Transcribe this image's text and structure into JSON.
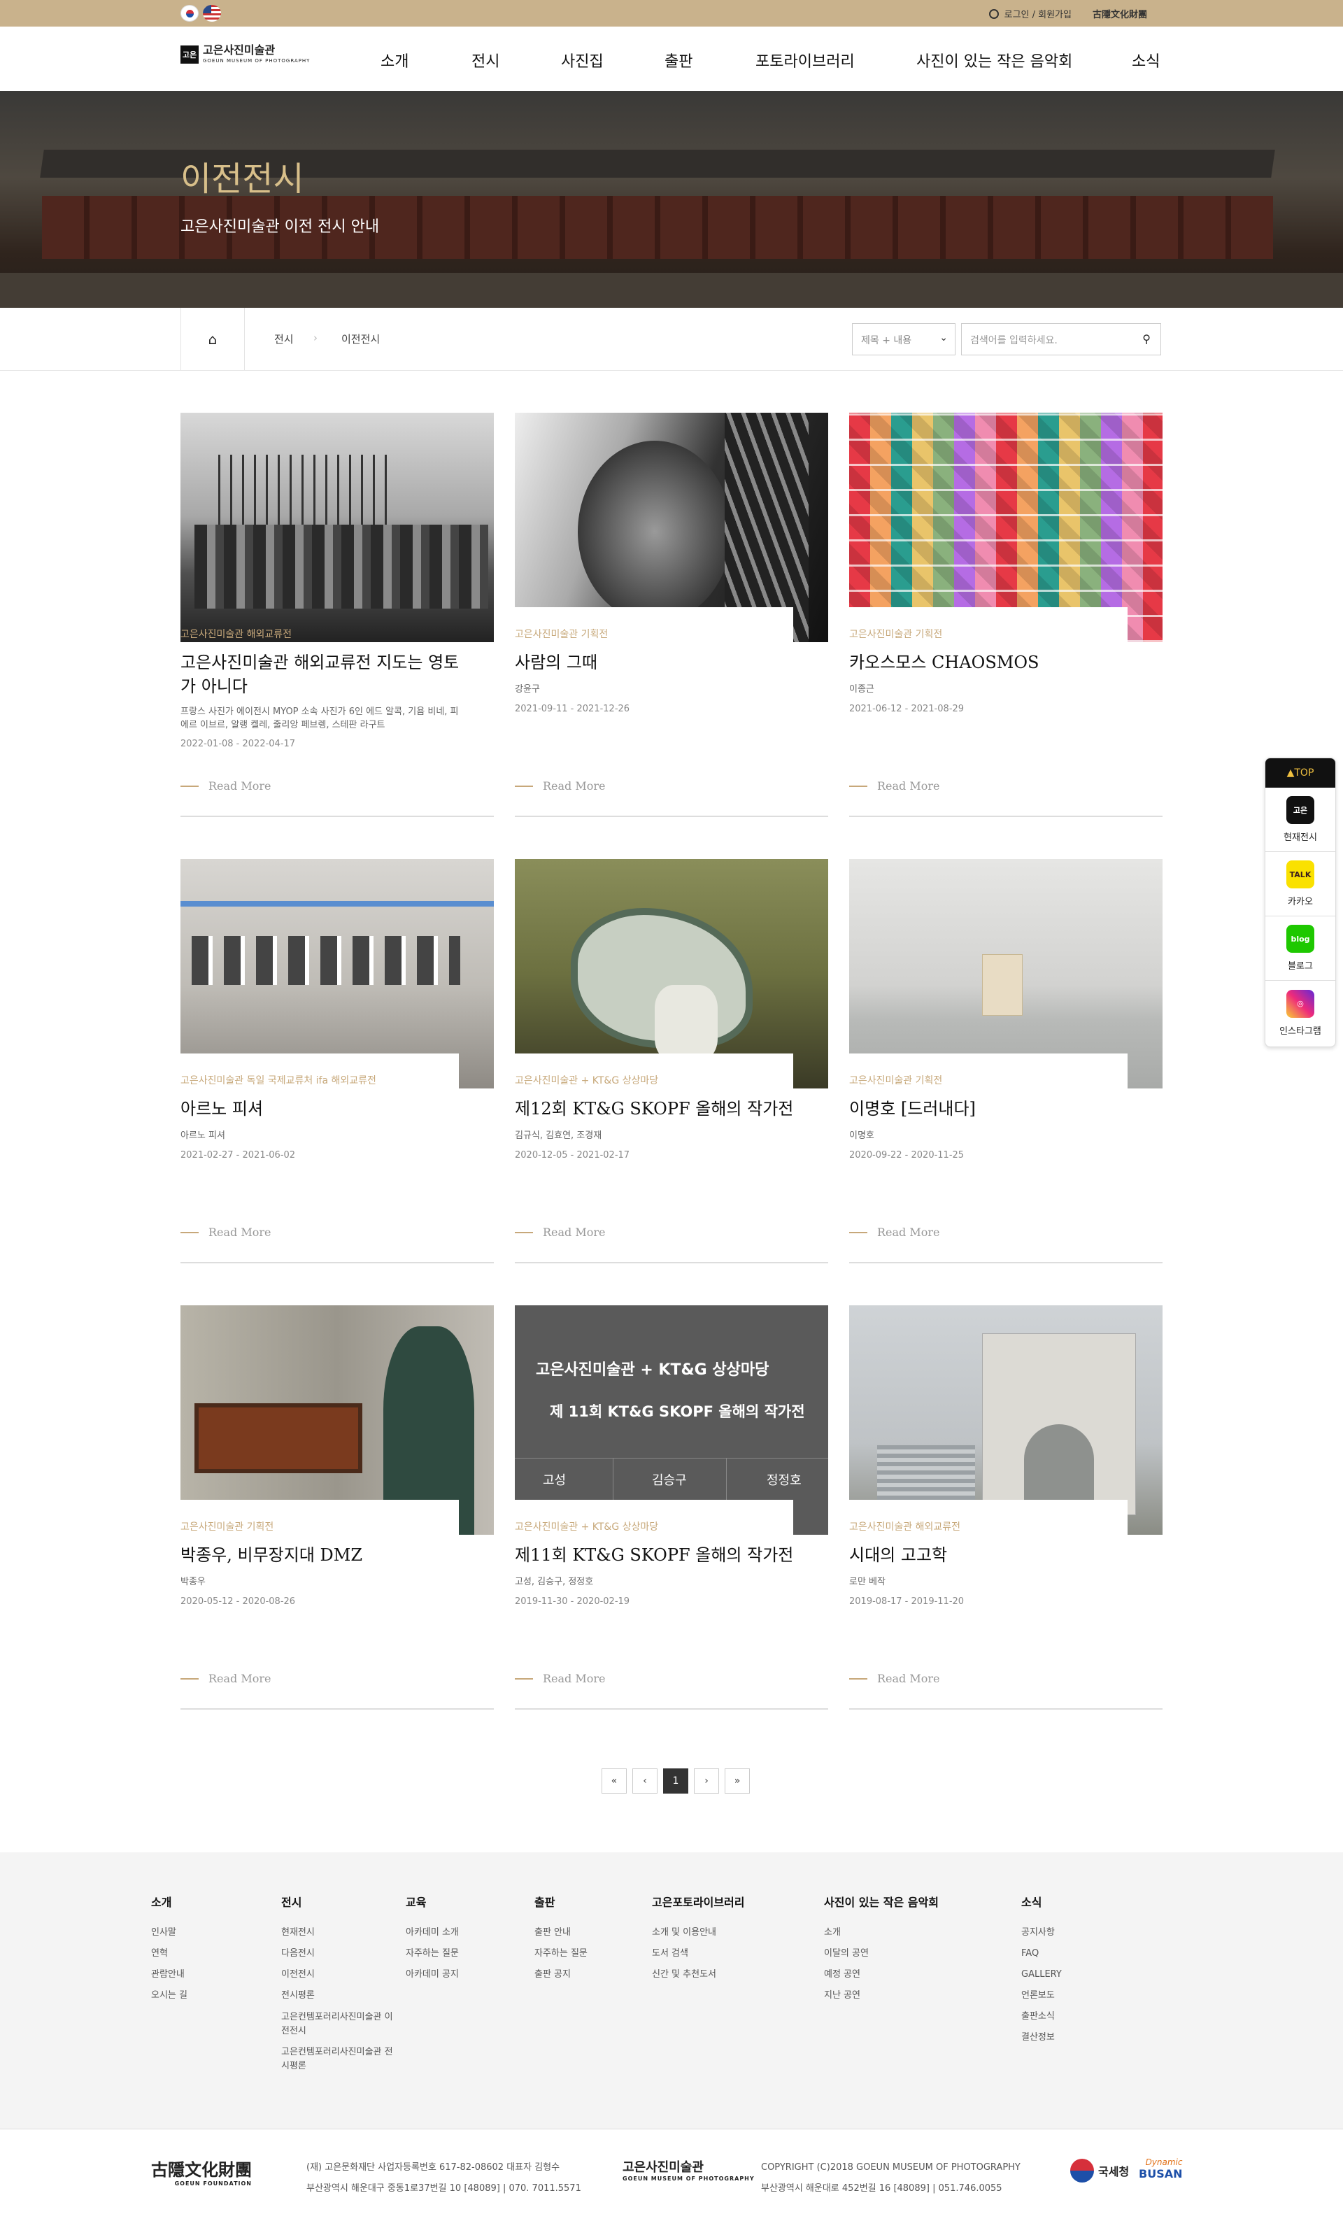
{
  "top": {
    "login": "로그인 / 회원가입",
    "foundation": "古隱文化財團"
  },
  "logo": {
    "mark": "고은",
    "name": "고은사진미술관",
    "sub": "GOEUN MUSEUM OF PHOTOGRAPHY"
  },
  "nav": [
    "소개",
    "전시",
    "사진집",
    "출판",
    "포토라이브러리",
    "사진이 있는 작은 음악회",
    "소식"
  ],
  "hero": {
    "title": "이전전시",
    "subtitle": "고은사진미술관 이전 전시 안내"
  },
  "breadcrumb": {
    "level1": "전시",
    "level2": "이전전시"
  },
  "search": {
    "select": "제목 + 내용",
    "placeholder": "검색어를 입력하세요."
  },
  "cards": [
    {
      "cat": "고은사진미술관 해외교류전",
      "title": "고은사진미술관 해외교류전 지도는 영토가 아니다",
      "artist": "프랑스 사진가 에이전시 MYOP 소속 사진가 6인 에드 알콕, 기욤 비네, 피에르 이브르, 알랭 켈레, 줄리앙 페브렝, 스테판 라구트",
      "date": "2022-01-08 - 2022-04-17",
      "more": "Read More"
    },
    {
      "cat": "고은사진미술관 기획전",
      "title": "사람의 그때",
      "artist": "강윤구",
      "date": "2021-09-11 - 2021-12-26",
      "more": "Read More"
    },
    {
      "cat": "고은사진미술관 기획전",
      "title": "카오스모스 CHAOSMOS",
      "artist": "이종근",
      "date": "2021-06-12 - 2021-08-29",
      "more": "Read More"
    },
    {
      "cat": "고은사진미술관 독일 국제교류처 ifa 해외교류전",
      "title": "아르노 피셔",
      "artist": "아르노 피셔",
      "date": "2021-02-27 - 2021-06-02",
      "more": "Read More"
    },
    {
      "cat": "고은사진미술관 + KT&G 상상마당",
      "title": "제12회 KT&G SKOPF 올해의 작가전",
      "artist": "김규식, 김효연, 조경재",
      "date": "2020-12-05 - 2021-02-17",
      "more": "Read More"
    },
    {
      "cat": "고은사진미술관 기획전",
      "title": "이명호 [드러내다]",
      "artist": "이명호",
      "date": "2020-09-22 - 2020-11-25",
      "more": "Read More"
    },
    {
      "cat": "고은사진미술관 기획전",
      "title": "박종우, 비무장지대 DMZ",
      "artist": "박종우",
      "date": "2020-05-12 - 2020-08-26",
      "more": "Read More"
    },
    {
      "cat": "고은사진미술관 + KT&G 상상마당",
      "title": "제11회 KT&G SKOPF 올해의 작가전",
      "artist": "고성, 김승구, 정정호",
      "date": "2019-11-30 - 2020-02-19",
      "more": "Read More"
    },
    {
      "cat": "고은사진미술관 해외교류전",
      "title": "시대의 고고학",
      "artist": "로만 베작",
      "date": "2019-08-17 - 2019-11-20",
      "more": "Read More"
    }
  ],
  "poster11": {
    "line1": "고은사진미술관 + KT&G 상상마당",
    "line2": "제 11회 KT&G SKOPF 올해의 작가전",
    "a1": "고성",
    "a2": "김승구",
    "a3": "정정호"
  },
  "pager": {
    "first": "«",
    "prev": "‹",
    "page": "1",
    "next": "›",
    "last": "»"
  },
  "quick": {
    "top": "▲TOP",
    "i1": "현재전시",
    "i2": "카카오",
    "i3": "블로그",
    "i4": "인스타그램",
    "ic1": "고은",
    "ic2": "TALK",
    "ic3": "blog"
  },
  "footer": {
    "cols": [
      {
        "h": "소개",
        "items": [
          "인사말",
          "연혁",
          "관람안내",
          "오시는 길"
        ]
      },
      {
        "h": "전시",
        "items": [
          "현재전시",
          "다음전시",
          "이전전시",
          "전시평론",
          "고은컨템포러리사진미술관 이전전시",
          "고은컨템포러리사진미술관 전시평론"
        ]
      },
      {
        "h": "교육",
        "items": [
          "아카데미 소개",
          "자주하는 질문",
          "아카데미 공지"
        ]
      },
      {
        "h": "출판",
        "items": [
          "출판 안내",
          "자주하는 질문",
          "출판 공지"
        ]
      },
      {
        "h": "고은포토라이브러리",
        "items": [
          "소개 및 이용안내",
          "도서 검색",
          "신간 및 추천도서"
        ]
      },
      {
        "h": "사진이 있는 작은 음악회",
        "items": [
          "소개",
          "이달의 공연",
          "예정 공연",
          "지난 공연"
        ]
      },
      {
        "h": "소식",
        "items": [
          "공지사항",
          "FAQ",
          "GALLERY",
          "언론보도",
          "출판소식",
          "결산정보"
        ]
      }
    ],
    "brand1": "古隱文化財團",
    "brand1sub": "GOEUN FOUNDATION",
    "info1a": "(재) 고은문화재단 사업자등록번호 617-82-08602 대표자 김형수",
    "info1b": "부산광역시 해운대구 중동1로37번길 10 [48089]  |  070. 7011.5571",
    "brand2": "고은사진미술관",
    "brand2sub": "GOEUN MUSEUM OF PHOTOGRAPHY",
    "info2a": "COPYRIGHT (C)2018 GOEUN MUSEUM OF PHOTOGRAPHY",
    "info2b": "부산광역시 해운대로 452번길 16 [48089]  |  051.746.0055",
    "nts": "국세청",
    "busan1": "Dynamic",
    "busan2": "BUSAN"
  }
}
